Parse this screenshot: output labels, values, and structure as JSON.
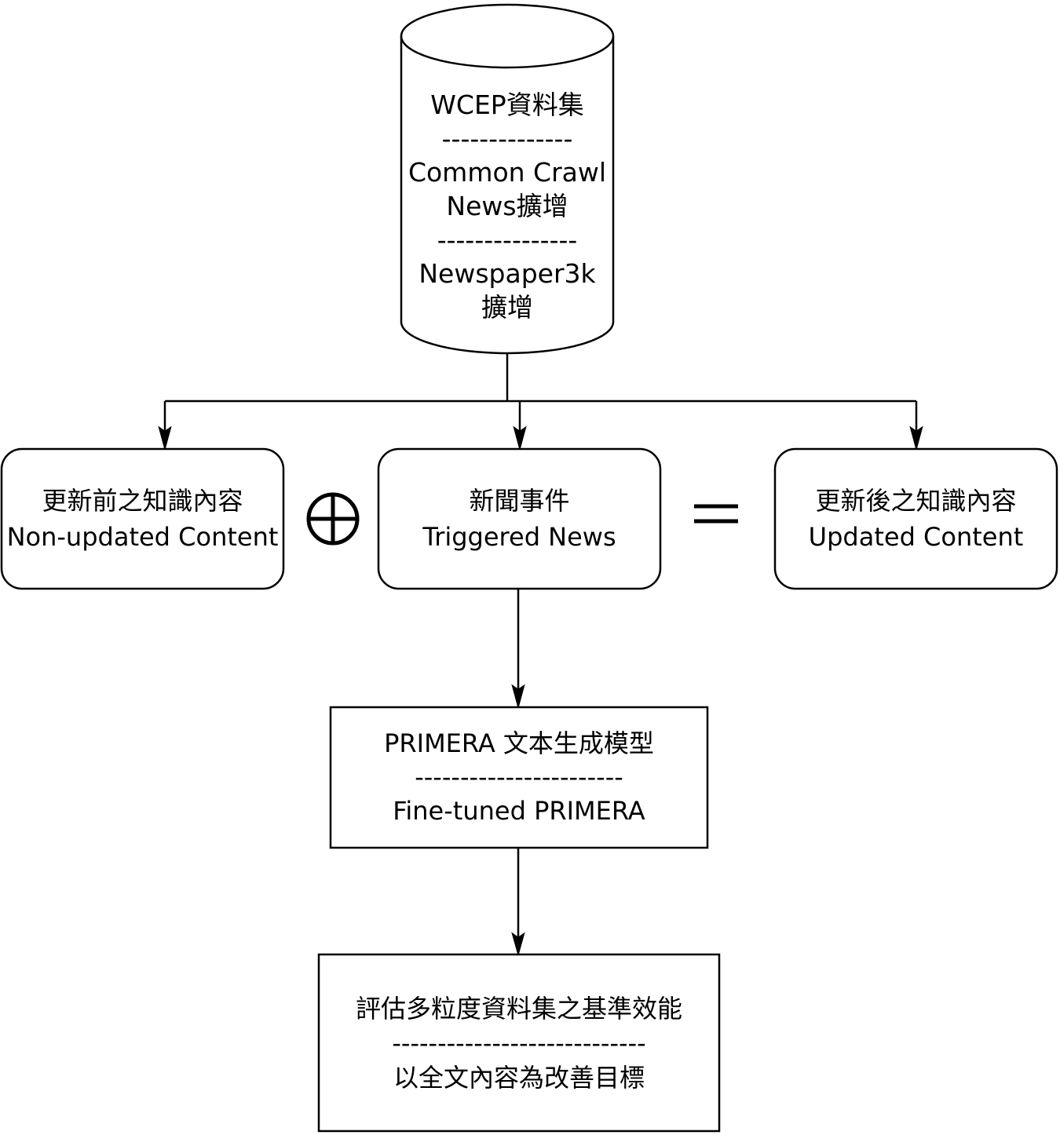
{
  "colors": {
    "stroke": "#000000",
    "fill": "#ffffff",
    "text": "#000000"
  },
  "dataset": {
    "line1": "WCEP資料集",
    "sep1": "--------------",
    "line2": "Common Crawl",
    "line3": "News擴增",
    "sep2": "---------------",
    "line4": "Newspaper3k",
    "line5": "擴增"
  },
  "non_updated": {
    "zh": "更新前之知識內容",
    "en": "Non-updated Content"
  },
  "triggered": {
    "zh": "新聞事件",
    "en": "Triggered News"
  },
  "updated": {
    "zh": "更新後之知識內容",
    "en": "Updated Content"
  },
  "model": {
    "line1": "PRIMERA 文本生成模型",
    "sep": "-----------------------",
    "line2": "Fine-tuned PRIMERA"
  },
  "evaluation": {
    "line1": "評估多粒度資料集之基準效能",
    "sep": "----------------------------",
    "line2": "以全文內容為改善目標"
  },
  "icons": {
    "plus": "circled-plus-icon",
    "equals": "equals-icon"
  }
}
